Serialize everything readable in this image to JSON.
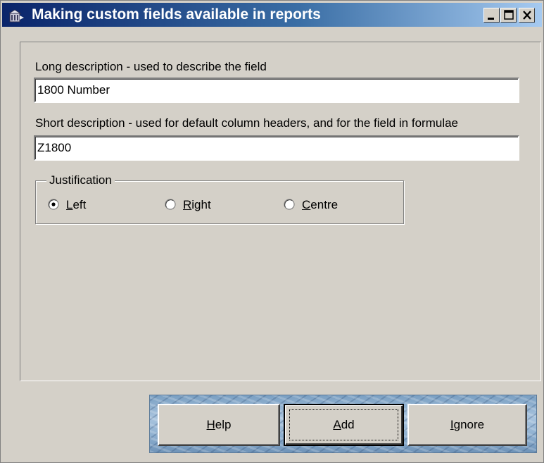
{
  "window": {
    "title": "Making custom fields available in reports",
    "icon": "building-icon",
    "controls": {
      "minimize": "minimize-icon",
      "maximize": "maximize-icon",
      "close": "close-icon"
    }
  },
  "form": {
    "long_description": {
      "label": "Long description - used to describe the field",
      "value": "1800 Number"
    },
    "short_description": {
      "label": "Short description - used for default column headers, and for the field in formulae",
      "value": "Z1800"
    },
    "justification": {
      "legend": "Justification",
      "options": [
        {
          "accel": "L",
          "rest": "eft",
          "selected": true
        },
        {
          "accel": "R",
          "rest": "ight",
          "selected": false
        },
        {
          "accel": "C",
          "rest": "entre",
          "selected": false
        }
      ]
    }
  },
  "buttons": {
    "help": {
      "accel": "H",
      "rest": "elp"
    },
    "add": {
      "accel": "A",
      "rest": "dd"
    },
    "ignore": {
      "accel": "I",
      "rest": "gnore"
    }
  },
  "colors": {
    "titlebar_start": "#0a246a",
    "titlebar_end": "#a6caf0",
    "face": "#d4d0c8"
  }
}
